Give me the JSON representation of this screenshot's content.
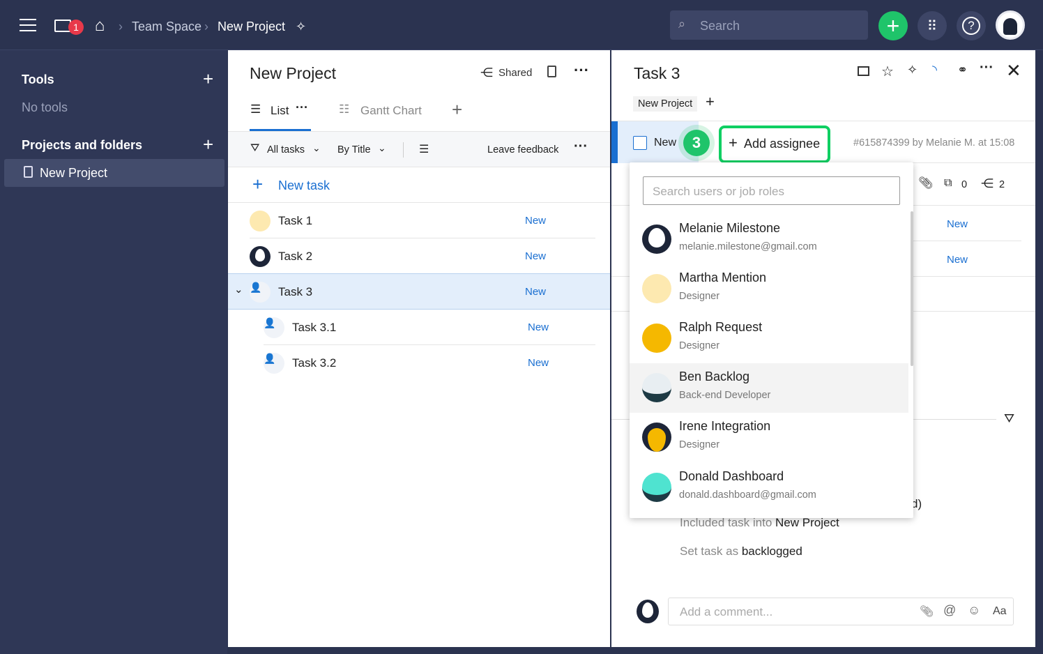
{
  "topbar": {
    "mail_badge": "1",
    "breadcrumb": [
      "Team Space",
      "New Project"
    ],
    "search_placeholder": "Search"
  },
  "sidebar": {
    "tools_title": "Tools",
    "no_tools": "No tools",
    "projects_title": "Projects and folders",
    "items": [
      {
        "label": "New Project"
      }
    ]
  },
  "project": {
    "title": "New Project",
    "shared": "Shared",
    "tabs": [
      {
        "label": "List"
      },
      {
        "label": "Gantt Chart"
      }
    ],
    "filter_all": "All tasks",
    "sort": "By Title",
    "feedback": "Leave feedback",
    "new_task": "New task",
    "tasks": [
      {
        "title": "Task 1",
        "status": "New"
      },
      {
        "title": "Task 2",
        "status": "New"
      },
      {
        "title": "Task 3",
        "status": "New"
      },
      {
        "title": "Task 3.1",
        "status": "New"
      },
      {
        "title": "Task 3.2",
        "status": "New"
      }
    ]
  },
  "detail": {
    "title": "Task 3",
    "project_tag": "New Project",
    "status": "New",
    "step": "3",
    "add_assignee": "Add assignee",
    "meta": "#615874399 by Melanie M. at 15:08",
    "subtasks_count": "0",
    "shares_count": "2",
    "sub_status": [
      "New",
      "New"
    ],
    "activity_partial": "d)",
    "activity": [
      {
        "prefix": "Included task into ",
        "value": "New Project"
      },
      {
        "prefix": "Set task as ",
        "value": "backlogged"
      }
    ],
    "comment_placeholder": "Add a comment...",
    "format_label": "Aa"
  },
  "dropdown": {
    "search_placeholder": "Search users or job roles",
    "users": [
      {
        "name": "Melanie Milestone",
        "sub": "melanie.milestone@gmail.com",
        "color": "#ffffff"
      },
      {
        "name": "Martha Mention",
        "sub": "Designer",
        "color": "#fde9b0"
      },
      {
        "name": "Ralph Request",
        "sub": "Designer",
        "color": "#f5b800"
      },
      {
        "name": "Ben Backlog",
        "sub": "Back-end Developer",
        "color": "#e8eef2"
      },
      {
        "name": "Irene Integration",
        "sub": "Designer",
        "color": "#f5b800"
      },
      {
        "name": "Donald Dashboard",
        "sub": "donald.dashboard@gmail.com",
        "color": "#4fe3d0"
      }
    ]
  },
  "colors": {
    "accent": "#1a6fd1",
    "green": "#1fc46a",
    "nav": "#2b3350"
  }
}
